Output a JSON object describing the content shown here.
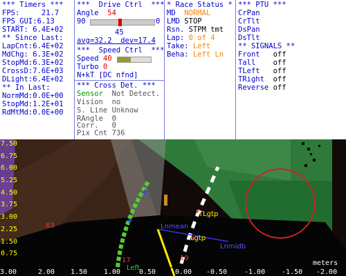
{
  "timers": {
    "header": "*** Timers ***",
    "fps_label": "FPS:",
    "fps": "21.7",
    "fps_gui_label": "FPS_GUI:",
    "fps_gui": "6.13",
    "start_label": "START:",
    "start": "6.4E+02",
    "since_header": "** Since Last:",
    "lapcnt_label": "LapCnt:",
    "lapcnt": "6.4E+02",
    "mdchg_label": "MdChg:",
    "mdchg": "6.3E+02",
    "stopmd_label": "StopMd:",
    "stopmd": "6.3E+02",
    "crossd_label": "CrossD:",
    "crossd": "7.6E+03",
    "dlight_label": "DLight:",
    "dlight": "6.4E+02",
    "inlast_header": "** In Last:",
    "normmd_label": "NormMd:",
    "normmd": "0.0E+00",
    "stopmd2_label": "StopMd:",
    "stopmd2": "1.2E+01",
    "rdmtmd_label": "RdMtMd:",
    "rdmtmd": "0.0E+00"
  },
  "drive": {
    "header": "***  Drive Ctrl  ***",
    "angle_label": "Angle",
    "angle": "54",
    "slider_min": "90",
    "slider_max": "0",
    "slider_level": 0.45,
    "slider_value": "45",
    "avg_text": "avg=32.2  dev=17.4",
    "speed_header": "***  Speed Ctrl  ***",
    "speed_label": "Speed",
    "speed": "40",
    "speed_level": 0.4,
    "turbo_label": "Turbo",
    "turbo": "0",
    "nkt_text": "N+kT [DC nfnd]",
    "cross_header": "*** Cross Det. ***",
    "sensor_label": "Sensor",
    "sensor": "Not Detect.",
    "vision_label": "Vision",
    "vision": "no",
    "sline_label": "S. Line",
    "sline": "Unknow",
    "rangle_label": "RAngle",
    "rangle": "0",
    "corr_label": "Corr.",
    "corr": "0",
    "pixcnt_label": "Pix Cnt",
    "pixcnt": "736"
  },
  "race": {
    "header": "* Race Status *",
    "md_label": "MD",
    "md": "NORMAL",
    "lmd_label": "LMD",
    "lmd": "STOP",
    "rsn_label": "Rsn.",
    "rsn": "STPM tmt",
    "lap_label": "Lap:",
    "lap": "0 of 4",
    "take_label": "Take:",
    "take": "Left",
    "beha_label": "Beha:",
    "beha": "Left Ln"
  },
  "ptu": {
    "header": "*** PTU ***",
    "items": [
      "CrPan",
      "CrTlt",
      "DsPan",
      "DsTlt"
    ],
    "signals_header": "** SIGNALS **",
    "signals": [
      {
        "name": "Front",
        "value": "off"
      },
      {
        "name": "Tall",
        "value": "off"
      },
      {
        "name": "TLeft",
        "value": "off"
      },
      {
        "name": "TRight",
        "value": "off"
      },
      {
        "name": "Reverse",
        "value": "off"
      }
    ]
  },
  "camera": {
    "y_ticks": [
      "7.50",
      "6.75",
      "6.00",
      "5.25",
      "4.50",
      "3.75",
      "3.00",
      "2.25",
      "1.50",
      "0.75"
    ],
    "x_ticks": [
      "3.00",
      "2.00",
      "1.50",
      "1.00",
      "0.50",
      "0.00",
      "-0.50",
      "-1.00",
      "-1.50",
      "-2.00"
    ],
    "units": "meters",
    "labels": {
      "tlgtp": "TLgtp",
      "lnmean": "Lnmean",
      "lgtp": "Lgtp",
      "lnmid": "Lnmidb",
      "left": "Left",
      "n63": "63",
      "n17": "17",
      "n19": "19"
    }
  }
}
